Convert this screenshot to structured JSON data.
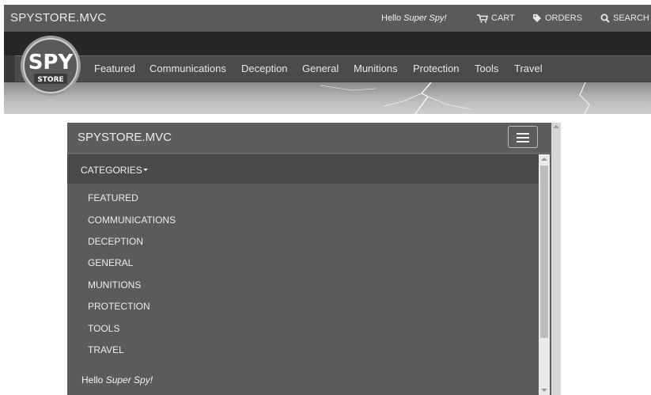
{
  "desktop": {
    "brand": "SPYSTORE.MVC",
    "hello_prefix": "Hello ",
    "hello_name": "Super Spy!",
    "links": [
      {
        "label": "CART",
        "icon": "cart-icon"
      },
      {
        "label": "ORDERS",
        "icon": "tag-icon"
      },
      {
        "label": "SEARCH",
        "icon": "search-icon"
      }
    ],
    "logo": {
      "top": "SPY",
      "bottom": "STORE"
    },
    "nav": [
      "Featured",
      "Communications",
      "Deception",
      "General",
      "Munitions",
      "Protection",
      "Tools",
      "Travel"
    ]
  },
  "mobile": {
    "brand": "SPYSTORE.MVC",
    "menu_icon": "hamburger-menu-icon",
    "categories_label": "CATEGORIES",
    "categories": [
      "FEATURED",
      "COMMUNICATIONS",
      "DECEPTION",
      "GENERAL",
      "MUNITIONS",
      "PROTECTION",
      "TOOLS",
      "TRAVEL"
    ],
    "hello_prefix": "Hello ",
    "hello_name": "Super Spy!"
  },
  "colors": {
    "topbar": "#5a5a5a",
    "navbar": "#4b4b4b",
    "mobile_bg": "#5b5b5b",
    "categories_bar": "#4a4a4a"
  }
}
